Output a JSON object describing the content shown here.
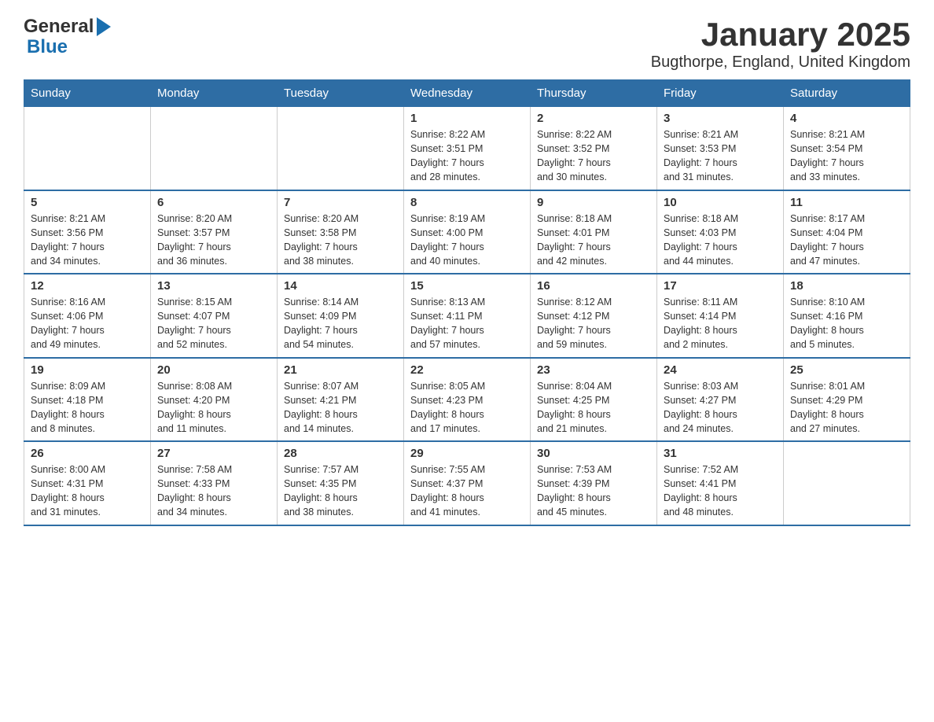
{
  "header": {
    "logo_general": "General",
    "logo_blue": "Blue",
    "title": "January 2025",
    "subtitle": "Bugthorpe, England, United Kingdom"
  },
  "days_of_week": [
    "Sunday",
    "Monday",
    "Tuesday",
    "Wednesday",
    "Thursday",
    "Friday",
    "Saturday"
  ],
  "weeks": [
    [
      {
        "day": "",
        "info": ""
      },
      {
        "day": "",
        "info": ""
      },
      {
        "day": "",
        "info": ""
      },
      {
        "day": "1",
        "info": "Sunrise: 8:22 AM\nSunset: 3:51 PM\nDaylight: 7 hours\nand 28 minutes."
      },
      {
        "day": "2",
        "info": "Sunrise: 8:22 AM\nSunset: 3:52 PM\nDaylight: 7 hours\nand 30 minutes."
      },
      {
        "day": "3",
        "info": "Sunrise: 8:21 AM\nSunset: 3:53 PM\nDaylight: 7 hours\nand 31 minutes."
      },
      {
        "day": "4",
        "info": "Sunrise: 8:21 AM\nSunset: 3:54 PM\nDaylight: 7 hours\nand 33 minutes."
      }
    ],
    [
      {
        "day": "5",
        "info": "Sunrise: 8:21 AM\nSunset: 3:56 PM\nDaylight: 7 hours\nand 34 minutes."
      },
      {
        "day": "6",
        "info": "Sunrise: 8:20 AM\nSunset: 3:57 PM\nDaylight: 7 hours\nand 36 minutes."
      },
      {
        "day": "7",
        "info": "Sunrise: 8:20 AM\nSunset: 3:58 PM\nDaylight: 7 hours\nand 38 minutes."
      },
      {
        "day": "8",
        "info": "Sunrise: 8:19 AM\nSunset: 4:00 PM\nDaylight: 7 hours\nand 40 minutes."
      },
      {
        "day": "9",
        "info": "Sunrise: 8:18 AM\nSunset: 4:01 PM\nDaylight: 7 hours\nand 42 minutes."
      },
      {
        "day": "10",
        "info": "Sunrise: 8:18 AM\nSunset: 4:03 PM\nDaylight: 7 hours\nand 44 minutes."
      },
      {
        "day": "11",
        "info": "Sunrise: 8:17 AM\nSunset: 4:04 PM\nDaylight: 7 hours\nand 47 minutes."
      }
    ],
    [
      {
        "day": "12",
        "info": "Sunrise: 8:16 AM\nSunset: 4:06 PM\nDaylight: 7 hours\nand 49 minutes."
      },
      {
        "day": "13",
        "info": "Sunrise: 8:15 AM\nSunset: 4:07 PM\nDaylight: 7 hours\nand 52 minutes."
      },
      {
        "day": "14",
        "info": "Sunrise: 8:14 AM\nSunset: 4:09 PM\nDaylight: 7 hours\nand 54 minutes."
      },
      {
        "day": "15",
        "info": "Sunrise: 8:13 AM\nSunset: 4:11 PM\nDaylight: 7 hours\nand 57 minutes."
      },
      {
        "day": "16",
        "info": "Sunrise: 8:12 AM\nSunset: 4:12 PM\nDaylight: 7 hours\nand 59 minutes."
      },
      {
        "day": "17",
        "info": "Sunrise: 8:11 AM\nSunset: 4:14 PM\nDaylight: 8 hours\nand 2 minutes."
      },
      {
        "day": "18",
        "info": "Sunrise: 8:10 AM\nSunset: 4:16 PM\nDaylight: 8 hours\nand 5 minutes."
      }
    ],
    [
      {
        "day": "19",
        "info": "Sunrise: 8:09 AM\nSunset: 4:18 PM\nDaylight: 8 hours\nand 8 minutes."
      },
      {
        "day": "20",
        "info": "Sunrise: 8:08 AM\nSunset: 4:20 PM\nDaylight: 8 hours\nand 11 minutes."
      },
      {
        "day": "21",
        "info": "Sunrise: 8:07 AM\nSunset: 4:21 PM\nDaylight: 8 hours\nand 14 minutes."
      },
      {
        "day": "22",
        "info": "Sunrise: 8:05 AM\nSunset: 4:23 PM\nDaylight: 8 hours\nand 17 minutes."
      },
      {
        "day": "23",
        "info": "Sunrise: 8:04 AM\nSunset: 4:25 PM\nDaylight: 8 hours\nand 21 minutes."
      },
      {
        "day": "24",
        "info": "Sunrise: 8:03 AM\nSunset: 4:27 PM\nDaylight: 8 hours\nand 24 minutes."
      },
      {
        "day": "25",
        "info": "Sunrise: 8:01 AM\nSunset: 4:29 PM\nDaylight: 8 hours\nand 27 minutes."
      }
    ],
    [
      {
        "day": "26",
        "info": "Sunrise: 8:00 AM\nSunset: 4:31 PM\nDaylight: 8 hours\nand 31 minutes."
      },
      {
        "day": "27",
        "info": "Sunrise: 7:58 AM\nSunset: 4:33 PM\nDaylight: 8 hours\nand 34 minutes."
      },
      {
        "day": "28",
        "info": "Sunrise: 7:57 AM\nSunset: 4:35 PM\nDaylight: 8 hours\nand 38 minutes."
      },
      {
        "day": "29",
        "info": "Sunrise: 7:55 AM\nSunset: 4:37 PM\nDaylight: 8 hours\nand 41 minutes."
      },
      {
        "day": "30",
        "info": "Sunrise: 7:53 AM\nSunset: 4:39 PM\nDaylight: 8 hours\nand 45 minutes."
      },
      {
        "day": "31",
        "info": "Sunrise: 7:52 AM\nSunset: 4:41 PM\nDaylight: 8 hours\nand 48 minutes."
      },
      {
        "day": "",
        "info": ""
      }
    ]
  ]
}
